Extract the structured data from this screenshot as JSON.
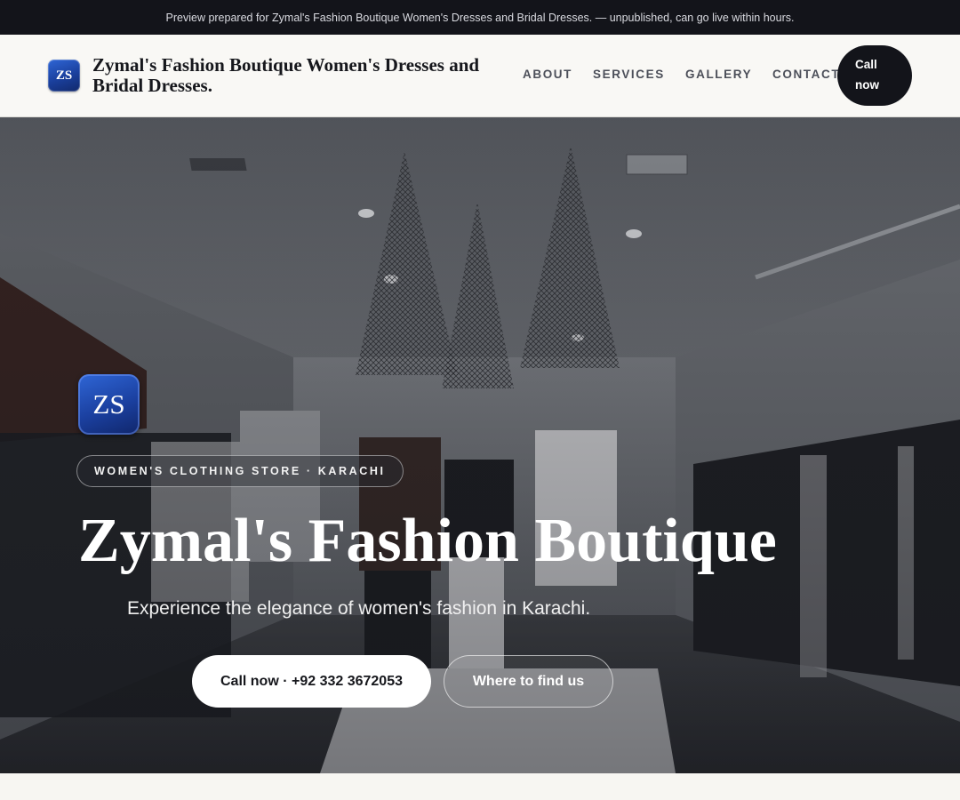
{
  "banner": {
    "text": "Preview prepared for Zymal's Fashion Boutique Women's Dresses and Bridal Dresses. — unpublished, can go live within hours."
  },
  "header": {
    "logo_initials": "ZS",
    "brand_name": "Zymal's Fashion Boutique Women's Dresses and Bridal Dresses.",
    "nav": [
      {
        "label": "ABOUT"
      },
      {
        "label": "SERVICES"
      },
      {
        "label": "GALLERY"
      },
      {
        "label": "CONTACT"
      }
    ],
    "call_label": "Call now"
  },
  "hero": {
    "logo_initials": "ZS",
    "eyebrow": "WOMEN'S CLOTHING STORE · KARACHI",
    "title": "Zymal's Fashion Boutique",
    "subtitle": "Experience the elegance of women's fashion in Karachi.",
    "primary_cta": "Call now · +92 332 3672053",
    "secondary_cta": "Where to find us"
  },
  "colors": {
    "dark": "#13141a",
    "accent_blue": "#1f4fb8",
    "background": "#f7f6f2"
  }
}
